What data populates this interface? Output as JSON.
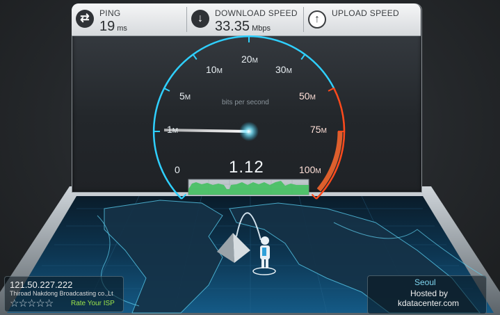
{
  "stats": {
    "ping": {
      "label": "PING",
      "value": "19",
      "unit": "ms"
    },
    "download": {
      "label": "DOWNLOAD SPEED",
      "value": "33.35",
      "unit": "Mbps"
    },
    "upload": {
      "label": "UPLOAD SPEED"
    }
  },
  "gauge": {
    "ticks": [
      {
        "value": "0",
        "unit": ""
      },
      {
        "value": "1",
        "unit": "M"
      },
      {
        "value": "5",
        "unit": "M"
      },
      {
        "value": "10",
        "unit": "M"
      },
      {
        "value": "20",
        "unit": "M"
      },
      {
        "value": "30",
        "unit": "M"
      },
      {
        "value": "50",
        "unit": "M"
      },
      {
        "value": "75",
        "unit": "M"
      },
      {
        "value": "100",
        "unit": "M"
      }
    ],
    "units_caption": "bits per second",
    "current_speed": "1.12"
  },
  "client": {
    "ip": "121.50.227.222",
    "isp": "Thiroad Nakdong Broadcasting co.,Lt",
    "rating_stars": 5,
    "rate_label": "Rate Your ISP"
  },
  "server": {
    "city": "Seoul",
    "hosted_by_label": "Hosted by",
    "host": "kdatacenter.com"
  },
  "colors": {
    "gauge_glow": "#2fd0ff",
    "gauge_red": "#ff4a1c",
    "graph_green": "#44c060",
    "map_blue": "#0d3f66",
    "rate_green": "#9ee64a"
  }
}
